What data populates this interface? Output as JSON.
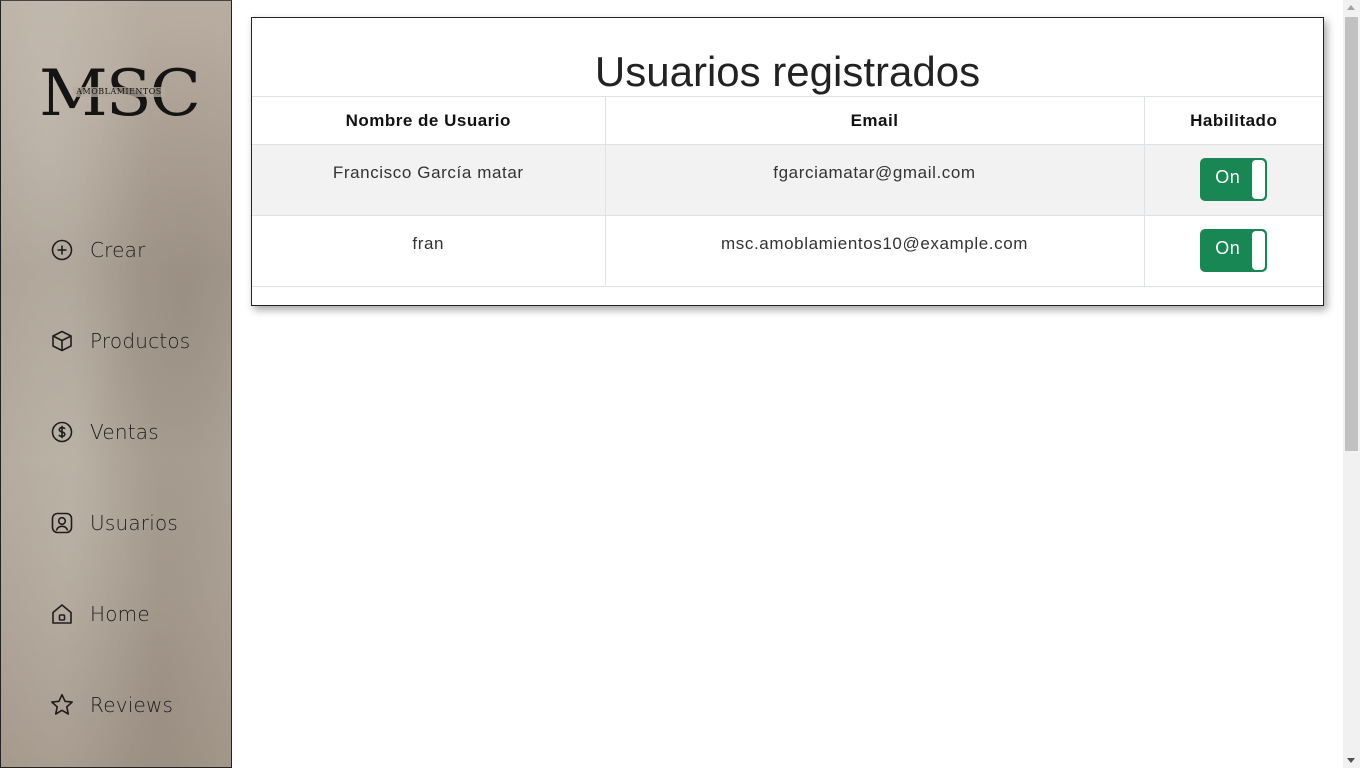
{
  "logo": {
    "text": "MSC",
    "subtext": "AMOBLAMIENTOS"
  },
  "sidebar": {
    "items": [
      {
        "label": "Crear",
        "icon": "plus-circle-icon"
      },
      {
        "label": "Productos",
        "icon": "box-icon"
      },
      {
        "label": "Ventas",
        "icon": "dollar-circle-icon"
      },
      {
        "label": "Usuarios",
        "icon": "user-square-icon"
      },
      {
        "label": "Home",
        "icon": "house-icon"
      },
      {
        "label": "Reviews",
        "icon": "star-icon"
      }
    ]
  },
  "main": {
    "title": "Usuarios registrados",
    "table": {
      "headers": [
        "Nombre de Usuario",
        "Email",
        "Habilitado"
      ],
      "rows": [
        {
          "name": "Francisco García matar",
          "email": "fgarciamatar@gmail.com",
          "enabled": "On"
        },
        {
          "name": "fran",
          "email": "msc.amoblamientos10@example.com",
          "enabled": "On"
        }
      ]
    }
  },
  "colors": {
    "toggle_on": "#198754",
    "row_alt": "#f2f2f2"
  }
}
